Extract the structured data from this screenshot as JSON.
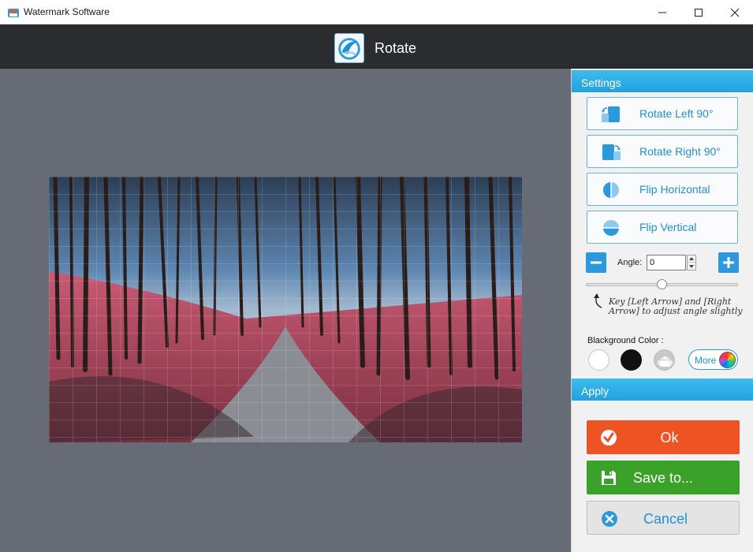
{
  "window": {
    "title": "Watermark Software",
    "controls": [
      "minimize-icon",
      "maximize-icon",
      "close-icon"
    ]
  },
  "header": {
    "title": "Rotate",
    "logo_icon": "app-logo-icon"
  },
  "panel": {
    "settings_title": "Settings",
    "tools": [
      {
        "label": "Rotate Left 90°",
        "icon": "rotate-left-icon"
      },
      {
        "label": "Rotate Right 90°",
        "icon": "rotate-right-icon"
      },
      {
        "label": "Flip Horizontal",
        "icon": "flip-horizontal-icon"
      },
      {
        "label": "Flip Vertical",
        "icon": "flip-vertical-icon"
      }
    ],
    "angle": {
      "label": "Angle:",
      "value": "0",
      "slider_fraction": 0.5
    },
    "hint": "Key [Left Arrow] and [Right Arrow] to adjust angle slightly",
    "background_color": {
      "label": "Blackground Color :",
      "swatches": [
        "#ffffff",
        "#111111",
        "transparent"
      ],
      "more_label": "More"
    },
    "apply_title": "Apply",
    "actions": {
      "ok": "Ok",
      "save": "Save to...",
      "cancel": "Cancel"
    }
  },
  "colors": {
    "accent": "#22a2df",
    "ok": "#f05323",
    "save": "#3aa229",
    "header": "#2b2c30",
    "canvas": "#676b76"
  }
}
